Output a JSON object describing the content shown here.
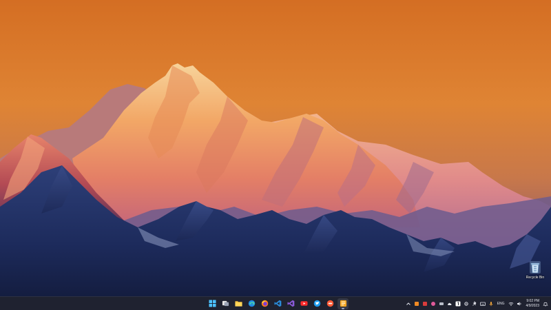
{
  "desktop": {
    "wallpaper_description": "",
    "recycle_bin": {
      "label": "Recycle Bin"
    }
  },
  "taskbar": {
    "pinned": [
      {
        "name": "start-button",
        "icon": "windows-logo-icon",
        "active": false
      },
      {
        "name": "task-view-button",
        "icon": "task-view-icon",
        "active": false
      },
      {
        "name": "file-explorer-button",
        "icon": "folder-icon",
        "active": false
      },
      {
        "name": "edge-button",
        "icon": "edge-icon",
        "active": false
      },
      {
        "name": "firefox-button",
        "icon": "firefox-icon",
        "active": false
      },
      {
        "name": "vscode-button",
        "icon": "vscode-icon",
        "active": false
      },
      {
        "name": "visual-studio-button",
        "icon": "visual-studio-icon",
        "active": false
      },
      {
        "name": "youtube-button",
        "icon": "youtube-icon",
        "active": false
      },
      {
        "name": "twitter-button",
        "icon": "twitter-icon",
        "active": false
      },
      {
        "name": "app-orange-button",
        "icon": "circle-app-icon",
        "active": false
      },
      {
        "name": "notes-app-button",
        "icon": "notes-icon",
        "active": true
      }
    ],
    "tray": {
      "language": "ENG",
      "time": "9:02 PM",
      "date": "4/9/2023"
    }
  },
  "colors": {
    "sky_top": "#d9762a",
    "sky_bottom": "#a05a5c",
    "taskbar": "#1f2230",
    "peak_light": "#f7c07d",
    "foreground_mountains": "#1c2a55"
  }
}
